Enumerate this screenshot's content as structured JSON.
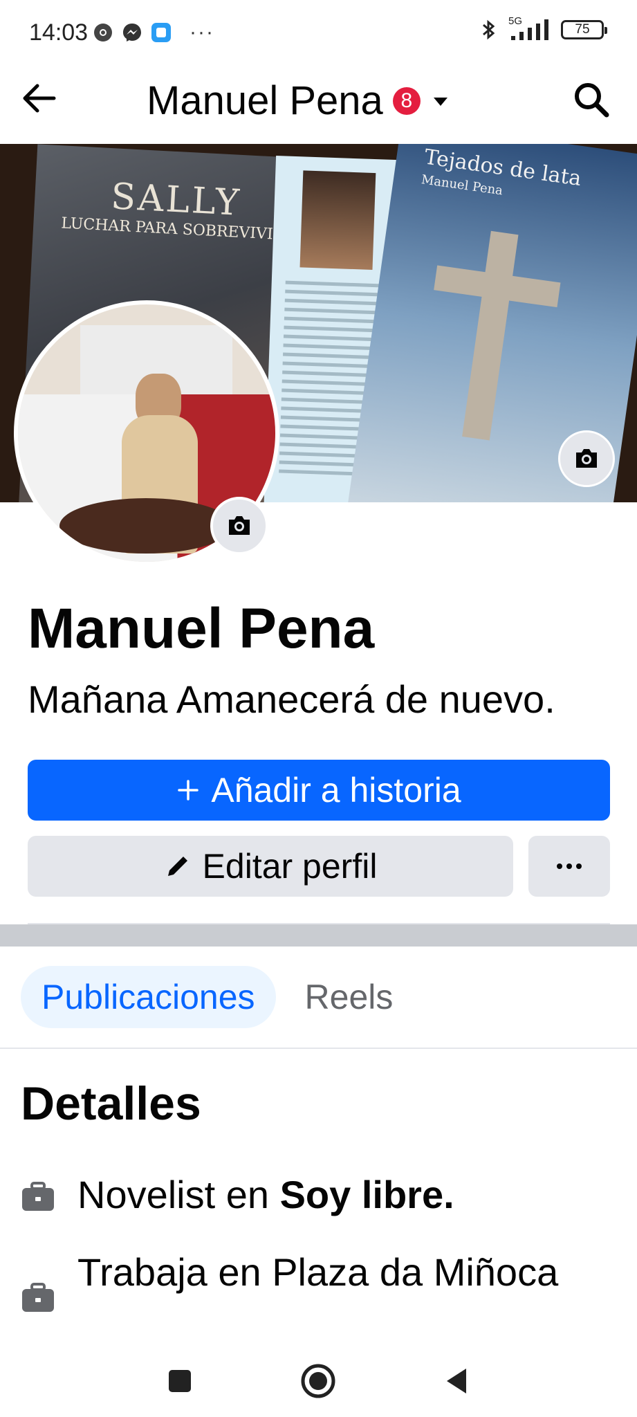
{
  "status_bar": {
    "time": "14:03",
    "left_icons": [
      "chrome-icon",
      "messenger-icon",
      "app-icon"
    ],
    "dots": "···",
    "network_label": "5G",
    "battery": "75"
  },
  "header": {
    "title": "Manuel Pena",
    "badge_count": "8"
  },
  "cover": {
    "book_left_title": "SALLY",
    "book_left_subtitle": "LUCHAR PARA SOBREVIVIR",
    "book_right_title": "Tejados de lata",
    "book_right_author": "Manuel Pena"
  },
  "profile": {
    "name": "Manuel Pena",
    "bio": "Mañana Amanecerá de nuevo."
  },
  "actions": {
    "add_story_label": "Añadir a historia",
    "edit_profile_label": "Editar perfil",
    "more_label": "···"
  },
  "tabs": [
    {
      "label": "Publicaciones",
      "active": true
    },
    {
      "label": "Reels",
      "active": false
    }
  ],
  "details": {
    "title": "Detalles",
    "items": [
      {
        "prefix": "Novelist en ",
        "bold": "Soy libre.",
        "icon": "briefcase-icon"
      },
      {
        "prefix": "Trabaja en Plaza da Miñoca",
        "bold": "",
        "icon": "briefcase-icon"
      }
    ]
  },
  "colors": {
    "primary": "#0866ff",
    "secondary_button": "#e4e6eb",
    "badge": "#e41e3f",
    "active_tab_bg": "#ebf5ff",
    "separator": "#c9ccd1"
  }
}
